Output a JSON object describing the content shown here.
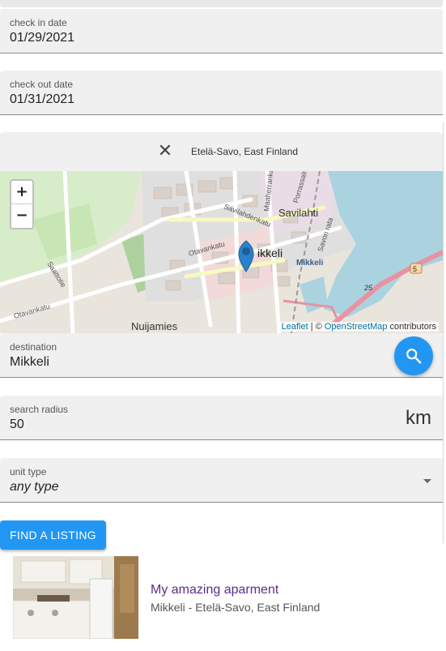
{
  "checkin": {
    "label": "check in date",
    "value": "01/29/2021"
  },
  "checkout": {
    "label": "check out date",
    "value": "01/31/2021"
  },
  "map_panel": {
    "close_icon": "close-icon",
    "region": "Etelä-Savo, East Finland",
    "zoom_in": "+",
    "zoom_out": "−",
    "labels": {
      "savilahti": "Savilahti",
      "mikkeli": "ikkeli",
      "mikkeli_station": "Mikkeli",
      "nuijamies": "Nuijamies",
      "savilahdenkatu": "Savilahdenkatu",
      "otavankatu": "Otavankatu",
      "otavankatu2": "Otavankatu",
      "saattotie": "Saattotie",
      "maaherrankatu": "Maaherrankatu",
      "porrassalmenkatu": "Porrassalmenkatu",
      "savon_rata": "Savon rata",
      "road_5": "5",
      "road_25": "25"
    },
    "attribution": {
      "leaflet": "Leaflet",
      "sep": " | © ",
      "osm": "OpenStreetMap",
      "tail": " contributors"
    }
  },
  "destination": {
    "label": "destination",
    "value": "Mikkeli",
    "button_icon": "search-icon"
  },
  "radius": {
    "label": "search radius",
    "value": "50",
    "unit": "km"
  },
  "unit_type": {
    "label": "unit type",
    "value": "any type"
  },
  "find_button": "FIND A LISTING",
  "listing": {
    "title": "My amazing aparment",
    "subtitle": "Mikkeli - Etelä-Savo, East Finland"
  },
  "colors": {
    "primary": "#2196f3",
    "listing_title": "#5b2c8a",
    "marker": "#2a81cb"
  }
}
